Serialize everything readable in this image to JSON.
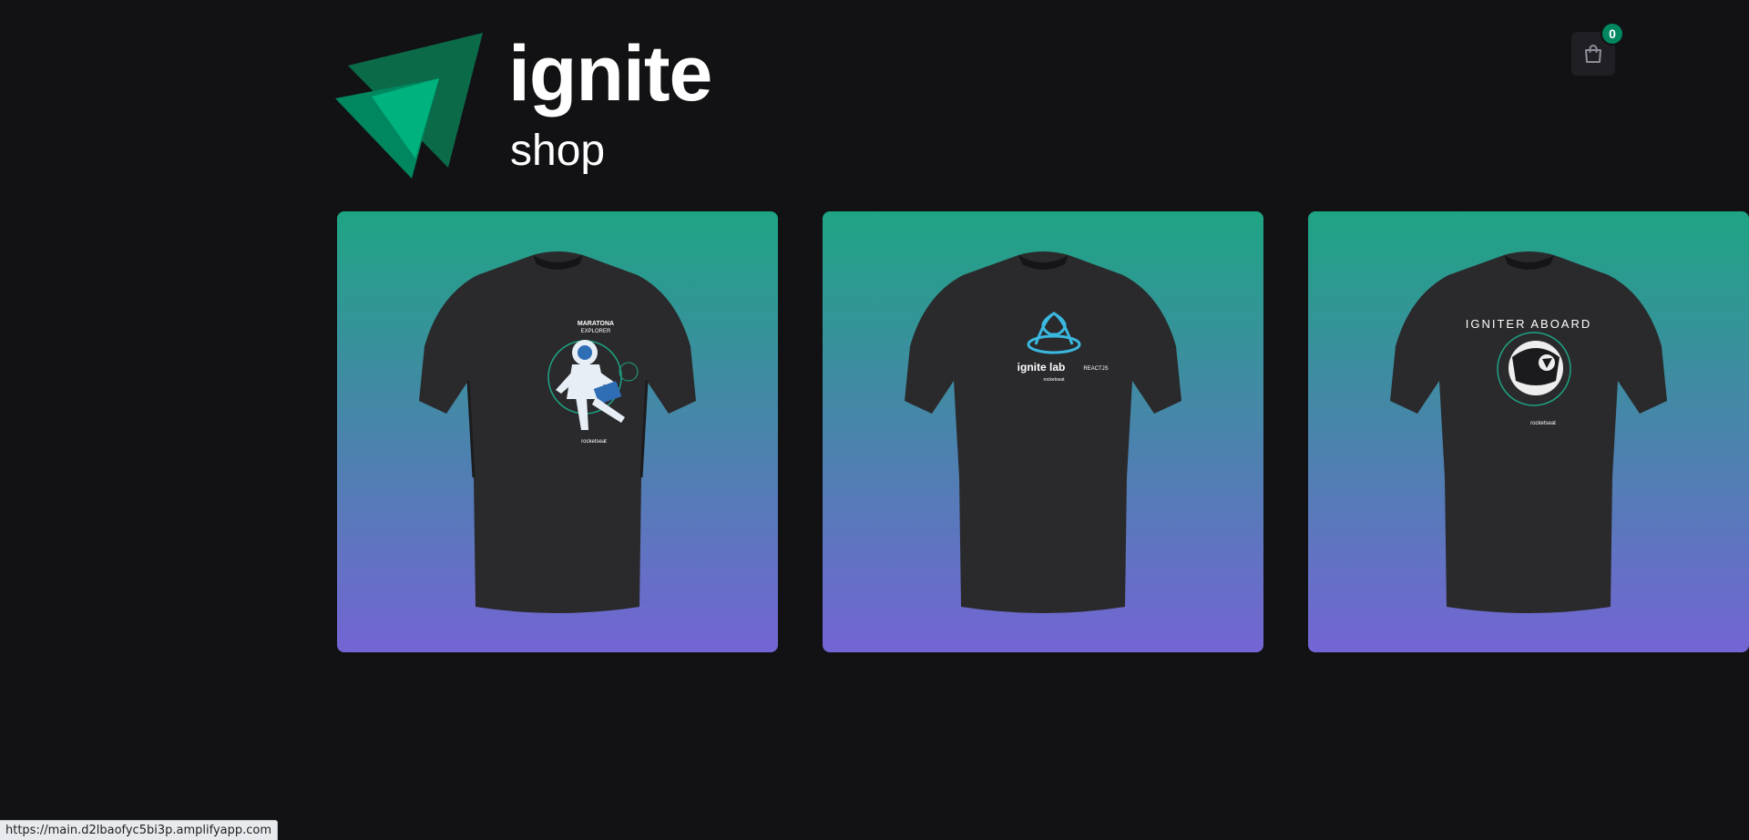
{
  "brand": {
    "title": "ignite",
    "subtitle": "shop",
    "colors": {
      "dark_green": "#0b6b49",
      "mid_green": "#00875f",
      "light_green": "#00b37e"
    }
  },
  "cart": {
    "icon": "handbag-icon",
    "count": "0"
  },
  "products": [
    {
      "name": "Maratona Explorer t-shirt",
      "print_title": "MARATONA",
      "print_subtitle": "EXPLORER",
      "brand_mark": "rocketseat"
    },
    {
      "name": "Ignite Lab t-shirt",
      "print_title": "ignite lab",
      "print_subtitle": "REACTJS",
      "brand_mark": "rocketseat"
    },
    {
      "name": "Igniter Aboard t-shirt",
      "print_title": "IGNITER ABOARD",
      "print_subtitle": "",
      "brand_mark": "rocketseat"
    }
  ],
  "card_gradient": {
    "top": "#1ea483",
    "bottom": "#7465d4"
  },
  "status_bar": {
    "url": "https://main.d2lbaofyc5bi3p.amplifyapp.com"
  }
}
